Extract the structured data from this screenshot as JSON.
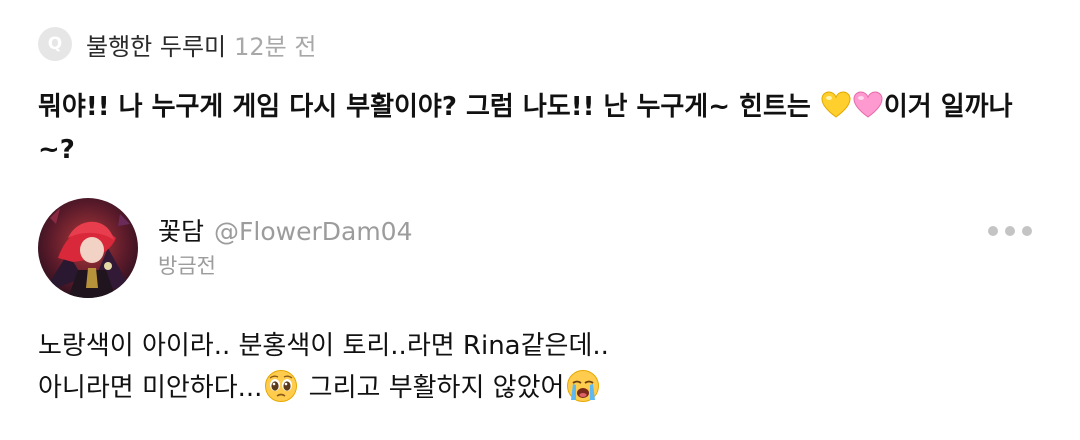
{
  "quoted_post": {
    "badge": "Q",
    "author": "불행한 두루미",
    "time": "12분 전",
    "text_part1": "뭐야!! 나 누구게 게임 다시 부활이야? 그럼 나도!! 난 누구게~ 힌트는 ",
    "emoji": [
      "yellow-heart",
      "pink-heart"
    ],
    "text_part2": "이거 일까나~?"
  },
  "comment": {
    "author_name": "꽃담",
    "author_handle": "@FlowerDam04",
    "time": "방금전",
    "line1": "노랑색이 아이라.. 분홍색이 토리..라면 Rina같은데..",
    "line2_part1": "아니라면 미안하다...",
    "line2_part2": " 그리고 부활하지 않았어",
    "emoji": [
      "pleading-face",
      "crying-face"
    ]
  },
  "colors": {
    "text": "#111111",
    "muted": "#9c9c9c",
    "badge_bg": "#e6e6e6",
    "dots": "#c4c4c4"
  }
}
